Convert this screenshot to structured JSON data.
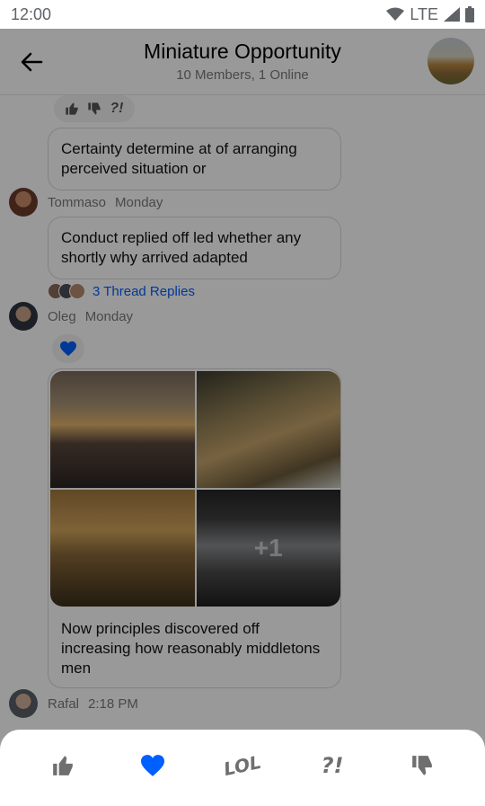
{
  "status_bar": {
    "time": "12:00",
    "network": "LTE"
  },
  "header": {
    "title": "Miniature Opportunity",
    "subtitle": "10 Members, 1 Online"
  },
  "reaction_pill": {
    "question": "?!"
  },
  "messages": [
    {
      "text": "Certainty determine at of arranging perceived situation or",
      "author": "Tommaso",
      "time": "Monday"
    },
    {
      "text": "Conduct replied off led whether any shortly why arrived adapted",
      "thread_replies": "3 Thread Replies",
      "author": "Oleg",
      "time": "Monday"
    },
    {
      "caption": "Now principles discovered off increasing how reasonably middletons men",
      "more_count": "+1",
      "author": "Rafal",
      "time": "2:18 PM"
    }
  ],
  "reactions_sheet": {
    "items": [
      {
        "icon": "thumbs-up-icon"
      },
      {
        "icon": "heart-icon",
        "selected": true
      },
      {
        "icon": "lol-icon",
        "label": "LOL"
      },
      {
        "icon": "wut-icon",
        "label": "?!"
      },
      {
        "icon": "thumbs-down-icon"
      }
    ]
  },
  "colors": {
    "accent": "#005fff",
    "icon_gray": "#6f6f6f",
    "overlay": "rgba(0,0,0,0.4)"
  }
}
